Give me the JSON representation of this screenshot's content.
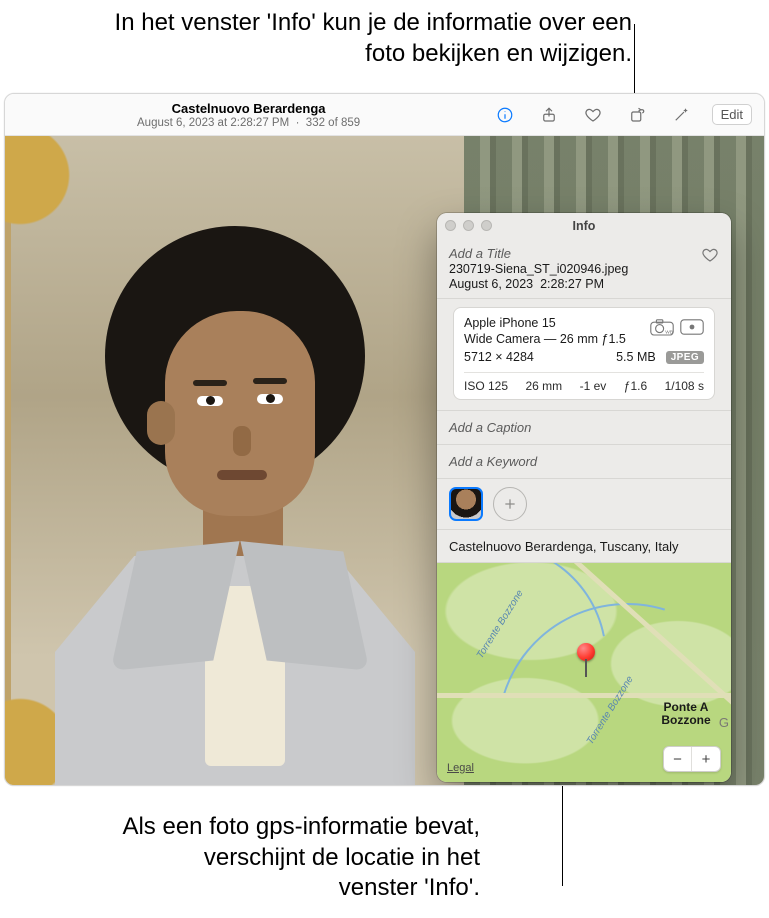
{
  "captions": {
    "top": "In het venster 'Info' kun je de informatie over een foto bekijken en wijzigen.",
    "bottom": "Als een foto gps-informatie bevat, verschijnt de locatie in het venster 'Info'."
  },
  "toolbar": {
    "location_title": "Castelnuovo Berardenga",
    "subtitle_date": "August 6, 2023 at 2:28:27 PM",
    "subtitle_sep": "·",
    "photo_index": "332 of 859",
    "edit_label": "Edit"
  },
  "info": {
    "window_title": "Info",
    "title_placeholder": "Add a Title",
    "filename": "230719-Siena_ST_i020946.jpeg",
    "date": "August 6, 2023",
    "time": "2:28:27 PM",
    "camera": {
      "model": "Apple iPhone 15",
      "lens": "Wide Camera — 26 mm ƒ1.5",
      "dimensions": "5712 × 4284",
      "filesize": "5.5 MB",
      "format_badge": "JPEG",
      "exif": {
        "iso": "ISO 125",
        "focal": "26 mm",
        "ev": "-1 ev",
        "aperture": "ƒ1.6",
        "shutter": "1/108 s"
      }
    },
    "caption_placeholder": "Add a Caption",
    "keyword_placeholder": "Add a Keyword",
    "location_text": "Castelnuovo Berardenga, Tuscany, Italy",
    "map": {
      "place_label": "Ponte A Bozzone",
      "river_label": "Torrente Bozzone",
      "legal": "Legal",
      "zoom_out": "−",
      "zoom_in": "+",
      "corner": "G"
    }
  }
}
